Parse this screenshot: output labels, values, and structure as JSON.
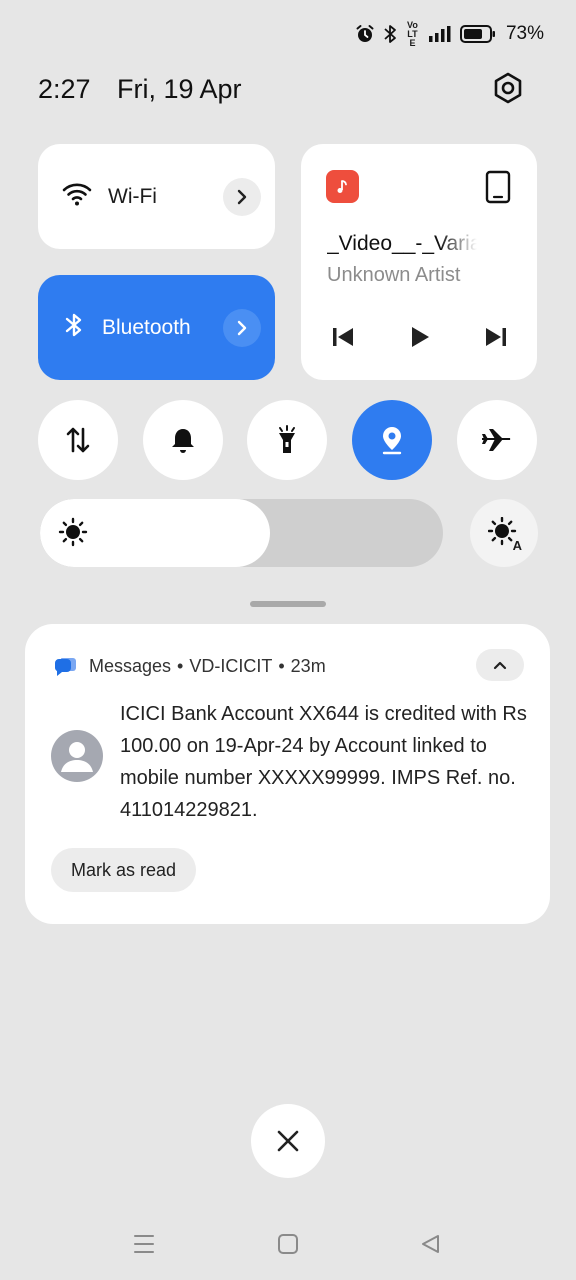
{
  "status_bar": {
    "icons": [
      "alarm-icon",
      "bluetooth-icon",
      "volte-icon",
      "signal-icon",
      "battery-icon"
    ],
    "volte_label": "Vo LTE",
    "battery_percent": "73%"
  },
  "header": {
    "time": "2:27",
    "date": "Fri, 19 Apr",
    "settings_icon": "gear-icon"
  },
  "tiles": {
    "wifi": {
      "label": "Wi-Fi",
      "active": false
    },
    "bluetooth": {
      "label": "Bluetooth",
      "active": true
    }
  },
  "media": {
    "title": "_Video__-_Variant",
    "artist": "Unknown Artist",
    "controls": [
      "previous-icon",
      "play-icon",
      "next-icon"
    ]
  },
  "toggles": [
    {
      "name": "mobile-data-icon",
      "active": false
    },
    {
      "name": "bell-icon",
      "active": false
    },
    {
      "name": "flashlight-icon",
      "active": false
    },
    {
      "name": "location-icon",
      "active": true
    },
    {
      "name": "airplane-icon",
      "active": false
    }
  ],
  "brightness": {
    "level": 0.57,
    "auto_label": "A"
  },
  "notification": {
    "app": "Messages",
    "sender": "VD-ICICIT",
    "age": "23m",
    "separator": "•",
    "body": "ICICI Bank Account XX644 is credited with Rs 100.00 on 19-Apr-24 by Account linked to mobile number XXXXX99999. IMPS Ref. no. 411014229821.",
    "action": "Mark as read"
  },
  "colors": {
    "accent": "#2f7cf0",
    "background": "#e6e6e6",
    "tile": "#ffffff",
    "music_badge": "#ee4e3d"
  }
}
